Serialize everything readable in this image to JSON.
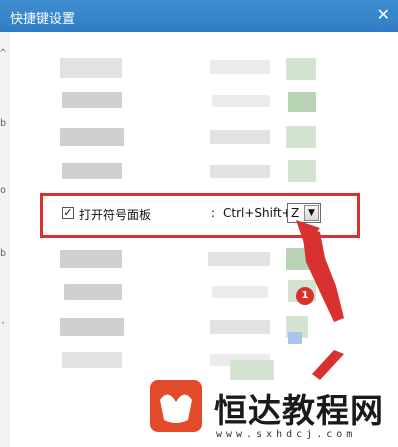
{
  "window": {
    "title": "快捷键设置",
    "close_glyph": "✕"
  },
  "highlight_row": {
    "checked": true,
    "check_glyph": "✓",
    "label": "打开符号面板",
    "separator": ":",
    "modifiers": "Ctrl+Shift+",
    "key_value": "Z",
    "dropdown_glyph": "▼"
  },
  "annotation": {
    "badge_number": "1",
    "color": "#d8312f"
  },
  "watermark": {
    "brand": "恒达教程网",
    "url": "www.sxhdcj.com"
  },
  "left_edge_glyphs": [
    "^",
    "·",
    "b",
    "o",
    "b",
    "·"
  ]
}
